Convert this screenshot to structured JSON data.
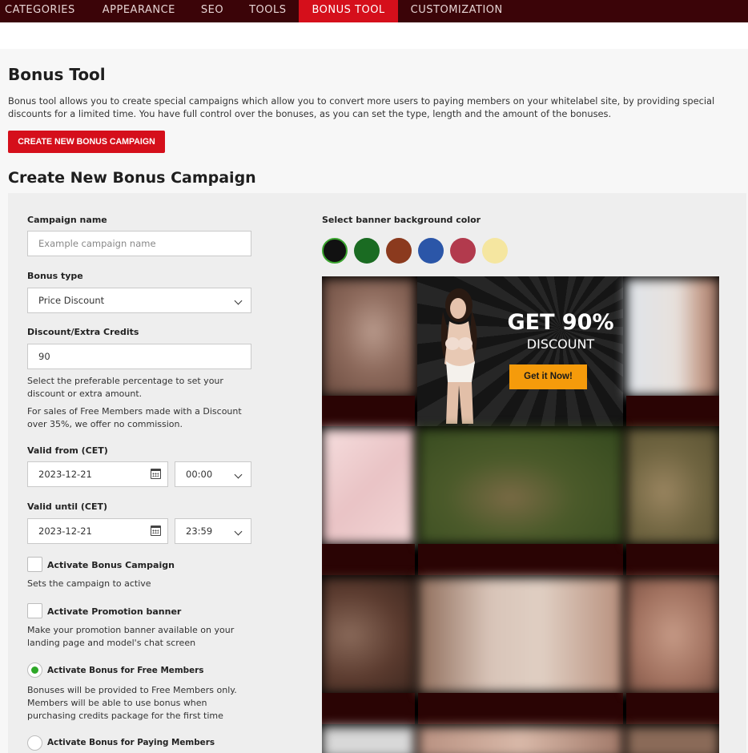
{
  "nav": {
    "tabs": [
      {
        "label": "CATEGORIES"
      },
      {
        "label": "APPEARANCE"
      },
      {
        "label": "SEO"
      },
      {
        "label": "TOOLS"
      },
      {
        "label": "BONUS TOOL",
        "active": true
      },
      {
        "label": "CUSTOMIZATION"
      }
    ]
  },
  "page": {
    "title": "Bonus Tool",
    "description": "Bonus tool allows you to create special campaigns which allow you to convert more users to paying members on your whitelabel site, by providing special discounts for a limited time. You have full control over the bonuses, as you can set the type, length and the amount of the bonuses.",
    "create_button": "CREATE NEW BONUS CAMPAIGN",
    "subtitle": "Create New Bonus Campaign"
  },
  "form": {
    "campaign_name": {
      "label": "Campaign name",
      "placeholder": "Example campaign name",
      "value": ""
    },
    "bonus_type": {
      "label": "Bonus type",
      "value": "Price Discount"
    },
    "discount": {
      "label": "Discount/Extra Credits",
      "value": "90",
      "help1": "Select the preferable percentage to set your discount or extra amount.",
      "help2": "For sales of Free Members made with a Discount over 35%, we offer no commission."
    },
    "valid_from": {
      "label": "Valid from (CET)",
      "date": "2023-12-21",
      "time": "00:00"
    },
    "valid_until": {
      "label": "Valid until (CET)",
      "date": "2023-12-21",
      "time": "23:59"
    },
    "activate_campaign": {
      "label": "Activate Bonus Campaign",
      "help": "Sets the campaign to active",
      "checked": false
    },
    "activate_banner": {
      "label": "Activate Promotion banner",
      "help": "Make your promotion banner available on your landing page and model's chat screen",
      "checked": false
    },
    "free_members": {
      "label": "Activate Bonus for Free Members",
      "help": "Bonuses will be provided to Free Members only. Members will be able to use bonus when purchasing credits package for the first time",
      "selected": true
    },
    "paying_members": {
      "label": "Activate Bonus for Paying Members",
      "selected": false
    }
  },
  "banner_colors": {
    "label": "Select banner background color",
    "swatches": [
      "#111111",
      "#1a6b22",
      "#8b3a1e",
      "#2b56a8",
      "#b23a4d",
      "#f5e6a0"
    ],
    "selected": "#111111"
  },
  "banner": {
    "headline": "GET 90%",
    "subline": "DISCOUNT",
    "cta": "Get it Now!"
  },
  "accent": "#d50f1b"
}
